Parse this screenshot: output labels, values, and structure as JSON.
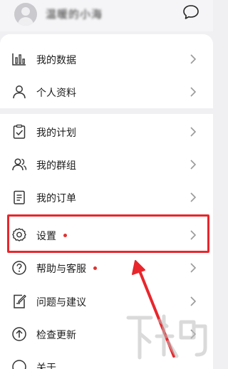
{
  "header": {
    "username": "温暖的小海",
    "chat_icon": "chat-bubble-icon"
  },
  "menu_group_1": [
    {
      "label": "我的数据",
      "icon": "bar-chart-icon"
    },
    {
      "label": "个人资料",
      "icon": "person-icon"
    }
  ],
  "menu_group_2": [
    {
      "label": "我的计划",
      "icon": "clipboard-check-icon"
    },
    {
      "label": "我的群组",
      "icon": "group-icon"
    },
    {
      "label": "我的订单",
      "icon": "order-list-icon"
    },
    {
      "label": "设置",
      "icon": "gear-icon",
      "badge_dot": true
    },
    {
      "label": "帮助与客服",
      "icon": "help-circle-icon",
      "badge_dot": true
    },
    {
      "label": "问题与建议",
      "icon": "feedback-edit-icon"
    },
    {
      "label": "检查更新",
      "icon": "update-arrow-icon"
    },
    {
      "label": "关于",
      "icon": "info-icon"
    }
  ],
  "colors": {
    "accent_red": "#e8262c",
    "badge_dot": "#e0322e",
    "background": "#f0f0f3",
    "card": "#ffffff"
  }
}
